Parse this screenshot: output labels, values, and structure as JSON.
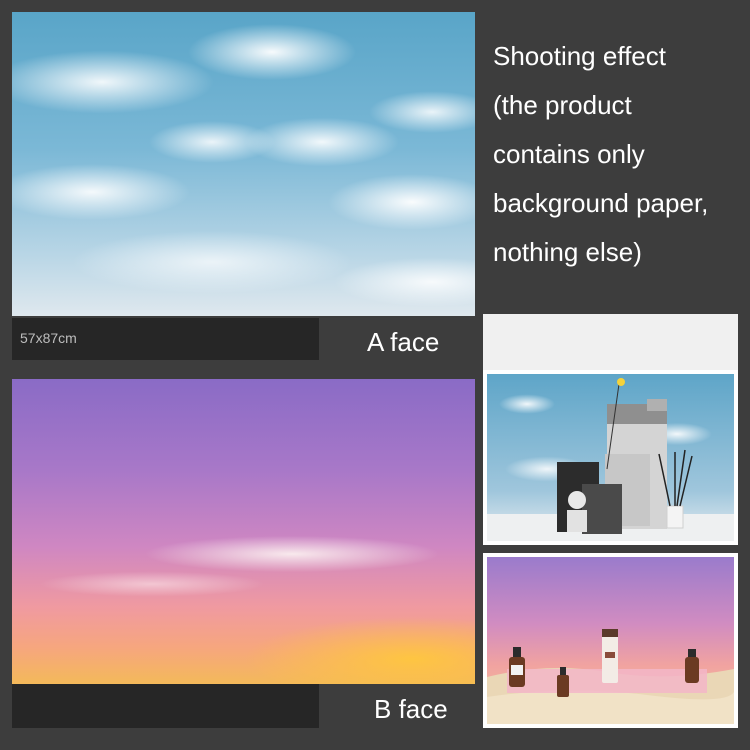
{
  "effect_text": {
    "lines": [
      "Shooting effect",
      "(the product",
      "contains only",
      "background paper,",
      "nothing else)"
    ]
  },
  "a_face": {
    "size_label": "57x87cm",
    "label": "A face"
  },
  "b_face": {
    "label": "B face"
  },
  "colors": {
    "background": "#3d3d3d",
    "caption_bar": "#262626",
    "text": "#ffffff"
  }
}
